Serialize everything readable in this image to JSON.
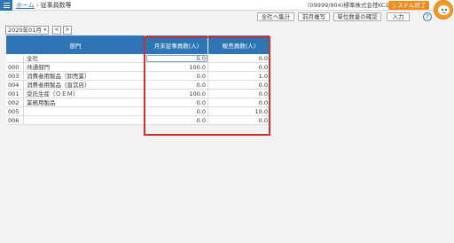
{
  "header": {
    "home_link": "ホーム",
    "separator": "›",
    "page_title": "従事員数等",
    "company": "(09999/904)標準株式会社",
    "user": "TKC1 ▾",
    "exit_label": "システム終了"
  },
  "toolbar": {
    "total_label": "全社へ集計",
    "prev_month_label": "前月複写",
    "unit_check_label": "単位数量の確認",
    "input_label": "入力",
    "help_label": "?"
  },
  "period": {
    "value": "2020年01月",
    "caret": "▾",
    "prev": "<",
    "next": ">"
  },
  "table": {
    "headers": [
      "部門",
      "月末従事員数(人)",
      "販売員数(人)"
    ],
    "rows": [
      {
        "code": "",
        "name": "全社",
        "v1": "5.0",
        "v2": "0.0"
      },
      {
        "code": "000",
        "name": "共通部門",
        "v1": "100.0",
        "v2": "0.0"
      },
      {
        "code": "003",
        "name": "消費者用製品（卸売業）",
        "v1": "0.0",
        "v2": "1.0"
      },
      {
        "code": "004",
        "name": "消費者用製品（直営店）",
        "v1": "0.0",
        "v2": "0.0"
      },
      {
        "code": "001",
        "name": "受託生産（ＯＥＭ）",
        "v1": "100.0",
        "v2": "0.0"
      },
      {
        "code": "002",
        "name": "業務用製品",
        "v1": "0.0",
        "v2": "0.0"
      },
      {
        "code": "005",
        "name": "",
        "v1": "0.0",
        "v2": "10.0"
      },
      {
        "code": "006",
        "name": "",
        "v1": "0.0",
        "v2": "0.0"
      }
    ]
  },
  "colors": {
    "accent": "#2e75b6",
    "exit_button": "#f08c1c",
    "highlight": "#d32f2f"
  }
}
